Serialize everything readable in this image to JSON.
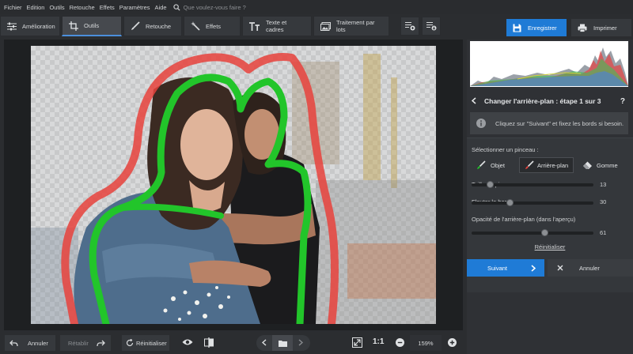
{
  "menubar": {
    "items": [
      "Fichier",
      "Edition",
      "Outils",
      "Retouche",
      "Effets",
      "Paramètres",
      "Aide"
    ],
    "search_placeholder": "Que voulez-vous faire ?"
  },
  "tabs": [
    {
      "label": "Amélioration",
      "icon": "sliders-icon",
      "active": false
    },
    {
      "label": "Outils",
      "icon": "crop-icon",
      "active": true
    },
    {
      "label": "Retouche",
      "icon": "brush-icon",
      "active": false
    },
    {
      "label": "Effets",
      "icon": "magic-wand-icon",
      "active": false
    },
    {
      "label": "Texte et cadres",
      "icon": "text-icon",
      "active": false
    },
    {
      "label": "Traitement par lots",
      "icon": "images-icon",
      "active": false
    }
  ],
  "top_actions": {
    "save_label": "Enregistrer",
    "print_label": "Imprimer"
  },
  "panel": {
    "step_title": "Changer l'arrière-plan : étape 1 sur 3",
    "help": "?",
    "info_text": "Cliquez sur \"Suivant\" et fixez les bords si besoin.",
    "brush_section_label": "Sélectionner un pinceau :",
    "brushes": [
      {
        "label": "Objet",
        "icon": "brush-object-icon",
        "active": false
      },
      {
        "label": "Arrière-plan",
        "icon": "brush-background-icon",
        "active": true
      },
      {
        "label": "Gomme",
        "icon": "eraser-icon",
        "active": false
      }
    ],
    "sliders": [
      {
        "label": "Taille du pinceau",
        "value": "13",
        "fraction": 0.13
      },
      {
        "label": "Flouter le bord",
        "value": "30",
        "fraction": 0.3
      },
      {
        "label": "Opacité de l'arrière-plan (dans l'aperçu)",
        "value": "61",
        "fraction": 0.61
      }
    ],
    "reset_label": "Réinitialiser",
    "next_label": "Suivant",
    "cancel_label": "Annuler"
  },
  "bottom": {
    "undo_label": "Annuler",
    "redo_label": "Rétablir",
    "reset_label": "Réinitialiser",
    "ratio_label": "1:1",
    "zoom_value": "159%"
  },
  "colors": {
    "accent": "#1f7bd6",
    "object_stroke": "#22c52a",
    "background_stroke": "#e8423c"
  }
}
